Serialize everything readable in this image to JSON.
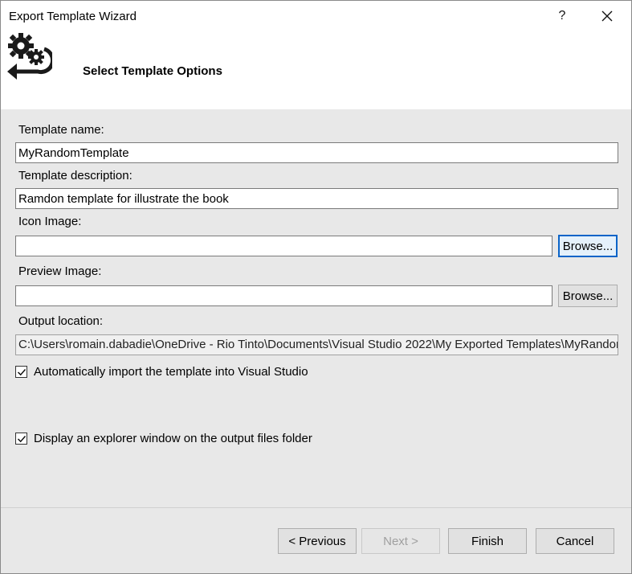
{
  "window": {
    "title": "Export Template Wizard",
    "help": "?",
    "close": "✕"
  },
  "header": {
    "title": "Select Template Options",
    "icon": "gears-arrow-icon"
  },
  "form": {
    "template_name_label": "Template name:",
    "template_name_value": "MyRandomTemplate",
    "template_description_label": "Template description:",
    "template_description_value": "Ramdon template for illustrate the book",
    "icon_image_label": "Icon Image:",
    "icon_image_value": "",
    "icon_browse_label": "Browse...",
    "preview_image_label": "Preview Image:",
    "preview_image_value": "",
    "preview_browse_label": "Browse...",
    "output_location_label": "Output location:",
    "output_location_value": "C:\\Users\\romain.dabadie\\OneDrive - Rio Tinto\\Documents\\Visual Studio 2022\\My Exported Templates\\MyRandomTemplate.zip",
    "auto_import_label": "Automatically import the template into Visual Studio",
    "auto_import_checked": true,
    "display_explorer_label": "Display an explorer window on the output files folder",
    "display_explorer_checked": true
  },
  "footer": {
    "previous_label": "< Previous",
    "next_label": "Next >",
    "finish_label": "Finish",
    "cancel_label": "Cancel"
  },
  "colors": {
    "content_bg": "#e8e8e8",
    "focus_border": "#0a64c8"
  }
}
